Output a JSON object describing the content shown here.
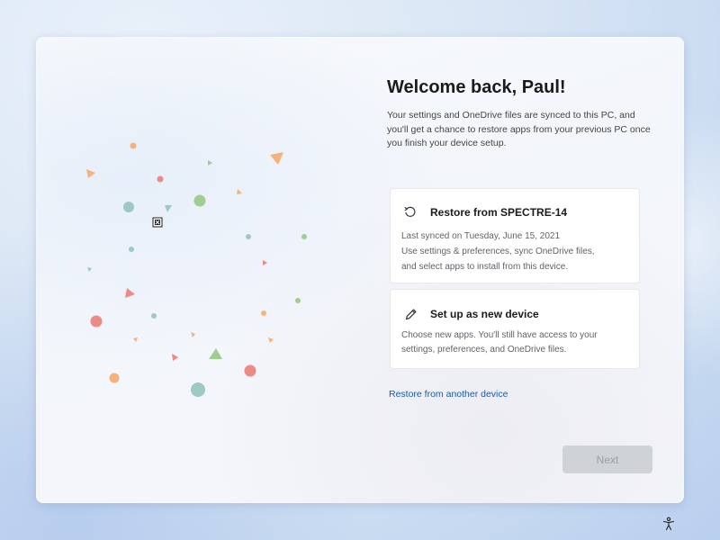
{
  "header": {
    "title": "Welcome back, Paul!",
    "description": "Your settings and OneDrive files are synced to this PC, and you'll get a chance to restore apps from your previous PC once you finish your device setup."
  },
  "options": {
    "restore": {
      "icon": "restore-icon",
      "title": "Restore from SPECTRE-14",
      "line1": "Last synced on Tuesday, June 15, 2021",
      "line2": "Use settings & preferences, sync OneDrive files,",
      "line3": "and select apps to install from this device."
    },
    "new_device": {
      "icon": "pencil-icon",
      "title": "Set up as new device",
      "line1": "Choose new apps. You'll still have access to your",
      "line2": "settings, preferences, and OneDrive files."
    }
  },
  "link": {
    "label": "Restore from another device"
  },
  "next_button": {
    "label": "Next",
    "state": "disabled"
  },
  "accessibility": {
    "icon": "accessibility-icon"
  },
  "colors": {
    "link": "#1a5aa6",
    "confetti_orange": "#f5b27a",
    "confetti_red": "#ec8a86",
    "confetti_green": "#9fcf90",
    "confetti_teal": "#9dc9c4"
  }
}
